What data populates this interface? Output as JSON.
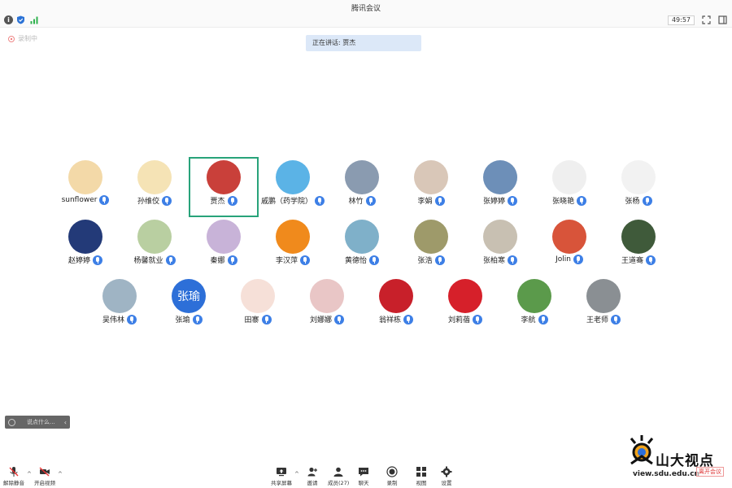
{
  "app": {
    "title": "腾讯会议",
    "timer": "49:57"
  },
  "status": {
    "recording_label": "录制中",
    "speaking_label": "正在讲话: 贾杰"
  },
  "participants": [
    {
      "name": "sunflower",
      "avatar_color": "#f3d9a8"
    },
    {
      "name": "孙维佼",
      "avatar_color": "#f5e3b5"
    },
    {
      "name": "贾杰",
      "avatar_color": "#c9403a",
      "highlight": true
    },
    {
      "name": "戚鹏（药学院）",
      "avatar_color": "#5bb3e6"
    },
    {
      "name": "林竹",
      "avatar_color": "#8a9bb0"
    },
    {
      "name": "李娟",
      "avatar_color": "#d9c7b8"
    },
    {
      "name": "张婷婷",
      "avatar_color": "#6d8fb8"
    },
    {
      "name": "张晓艳",
      "avatar_color": "#efefef"
    },
    {
      "name": "张杨",
      "avatar_color": "#f2f2f2"
    },
    {
      "name": "赵婷婷",
      "avatar_color": "#233a78"
    },
    {
      "name": "杨馨就业",
      "avatar_color": "#b9cfa1"
    },
    {
      "name": "秦娜",
      "avatar_color": "#c8b3d8"
    },
    {
      "name": "李汉萍",
      "avatar_color": "#f08a1c"
    },
    {
      "name": "黄德怡",
      "avatar_color": "#7fb0c9"
    },
    {
      "name": "张浩",
      "avatar_color": "#9e9a6a"
    },
    {
      "name": "张柏寒",
      "avatar_color": "#c8c0b2"
    },
    {
      "name": "Jolin",
      "avatar_color": "#d8543a"
    },
    {
      "name": "王道骞",
      "avatar_color": "#3f5a3a"
    },
    {
      "name": "吴伟林",
      "avatar_color": "#9fb4c4"
    },
    {
      "name": "张瑜",
      "avatar_color": "#2d6fd8",
      "avatar_text": "张瑜"
    },
    {
      "name": "田寨",
      "avatar_color": "#f6e0d8"
    },
    {
      "name": "刘娜娜",
      "avatar_color": "#e9c6c6"
    },
    {
      "name": "翁祥栋",
      "avatar_color": "#c8202a"
    },
    {
      "name": "刘莉蓓",
      "avatar_color": "#d6202a"
    },
    {
      "name": "李航",
      "avatar_color": "#5b9a4b"
    },
    {
      "name": "王老师",
      "avatar_color": "#8a8f93"
    }
  ],
  "chat": {
    "placeholder": "说点什么..."
  },
  "toolbar": {
    "items": [
      {
        "label": "解除静音"
      },
      {
        "label": "开启视频"
      },
      {
        "label": "共享屏幕"
      },
      {
        "label": "邀请"
      },
      {
        "label": "成员(27)"
      },
      {
        "label": "聊天"
      },
      {
        "label": "录制"
      },
      {
        "label": "视图"
      },
      {
        "label": "设置"
      }
    ]
  },
  "watermark": {
    "title": "山大视点",
    "url": "view.sdu.edu.cn"
  },
  "end_meeting_label": "离开会议"
}
